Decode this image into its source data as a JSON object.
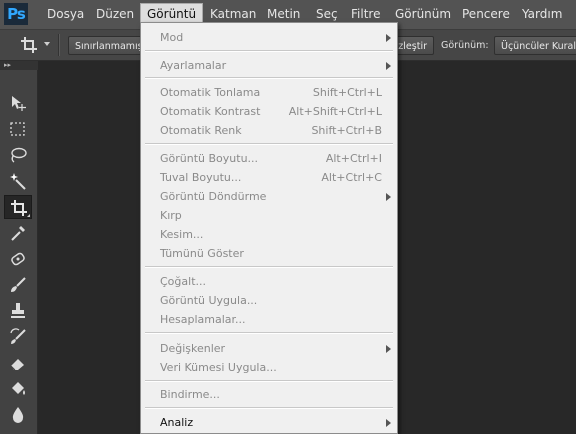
{
  "app": {
    "logo_text": "Ps"
  },
  "menubar": {
    "items": [
      {
        "label": "Dosya"
      },
      {
        "label": "Düzen"
      },
      {
        "label": "Görüntü"
      },
      {
        "label": "Katman"
      },
      {
        "label": "Metin"
      },
      {
        "label": "Seç"
      },
      {
        "label": "Filtre"
      },
      {
        "label": "Görünüm"
      },
      {
        "label": "Pencere"
      },
      {
        "label": "Yardım"
      }
    ],
    "active_item": "Görüntü"
  },
  "options_bar": {
    "active_tool_icon": "crop-icon",
    "constraint_button": "Sınırlanmamış",
    "straighten_label": "üzleştir",
    "view_label": "Görünüm:",
    "view_value": "Üçüncüler Kuralı"
  },
  "tools": [
    {
      "icon": "move-icon"
    },
    {
      "icon": "rectangular-marquee-icon"
    },
    {
      "icon": "lasso-icon"
    },
    {
      "icon": "magic-wand-icon"
    },
    {
      "icon": "crop-icon",
      "active": true
    },
    {
      "icon": "eyedropper-icon"
    },
    {
      "icon": "healing-brush-icon"
    },
    {
      "icon": "brush-icon"
    },
    {
      "icon": "clone-stamp-icon"
    },
    {
      "icon": "history-brush-icon"
    },
    {
      "icon": "eraser-icon"
    },
    {
      "icon": "paint-bucket-icon"
    },
    {
      "icon": "blur-icon"
    }
  ],
  "image_menu": {
    "items": [
      {
        "label": "Mod",
        "shortcut": "",
        "submenu": true,
        "enabled": false
      },
      {
        "label": "Ayarlamalar",
        "shortcut": "",
        "submenu": true,
        "enabled": false
      },
      {
        "label": "Otomatik Tonlama",
        "shortcut": "Shift+Ctrl+L",
        "submenu": false,
        "enabled": false
      },
      {
        "label": "Otomatik Kontrast",
        "shortcut": "Alt+Shift+Ctrl+L",
        "submenu": false,
        "enabled": false
      },
      {
        "label": "Otomatik Renk",
        "shortcut": "Shift+Ctrl+B",
        "submenu": false,
        "enabled": false
      },
      {
        "label": "Görüntü Boyutu...",
        "shortcut": "Alt+Ctrl+I",
        "submenu": false,
        "enabled": false
      },
      {
        "label": "Tuval Boyutu...",
        "shortcut": "Alt+Ctrl+C",
        "submenu": false,
        "enabled": false
      },
      {
        "label": "Görüntü Döndürme",
        "shortcut": "",
        "submenu": true,
        "enabled": false
      },
      {
        "label": "Kırp",
        "shortcut": "",
        "submenu": false,
        "enabled": false
      },
      {
        "label": "Kesim...",
        "shortcut": "",
        "submenu": false,
        "enabled": false
      },
      {
        "label": "Tümünü Göster",
        "shortcut": "",
        "submenu": false,
        "enabled": false
      },
      {
        "label": "Çoğalt...",
        "shortcut": "",
        "submenu": false,
        "enabled": false
      },
      {
        "label": "Görüntü Uygula...",
        "shortcut": "",
        "submenu": false,
        "enabled": false
      },
      {
        "label": "Hesaplamalar...",
        "shortcut": "",
        "submenu": false,
        "enabled": false
      },
      {
        "label": "Değişkenler",
        "shortcut": "",
        "submenu": true,
        "enabled": false
      },
      {
        "label": "Veri Kümesi Uygula...",
        "shortcut": "",
        "submenu": false,
        "enabled": false
      },
      {
        "label": "Bindirme...",
        "shortcut": "",
        "submenu": false,
        "enabled": false
      },
      {
        "label": "Analiz",
        "shortcut": "",
        "submenu": true,
        "enabled": true
      }
    ]
  }
}
